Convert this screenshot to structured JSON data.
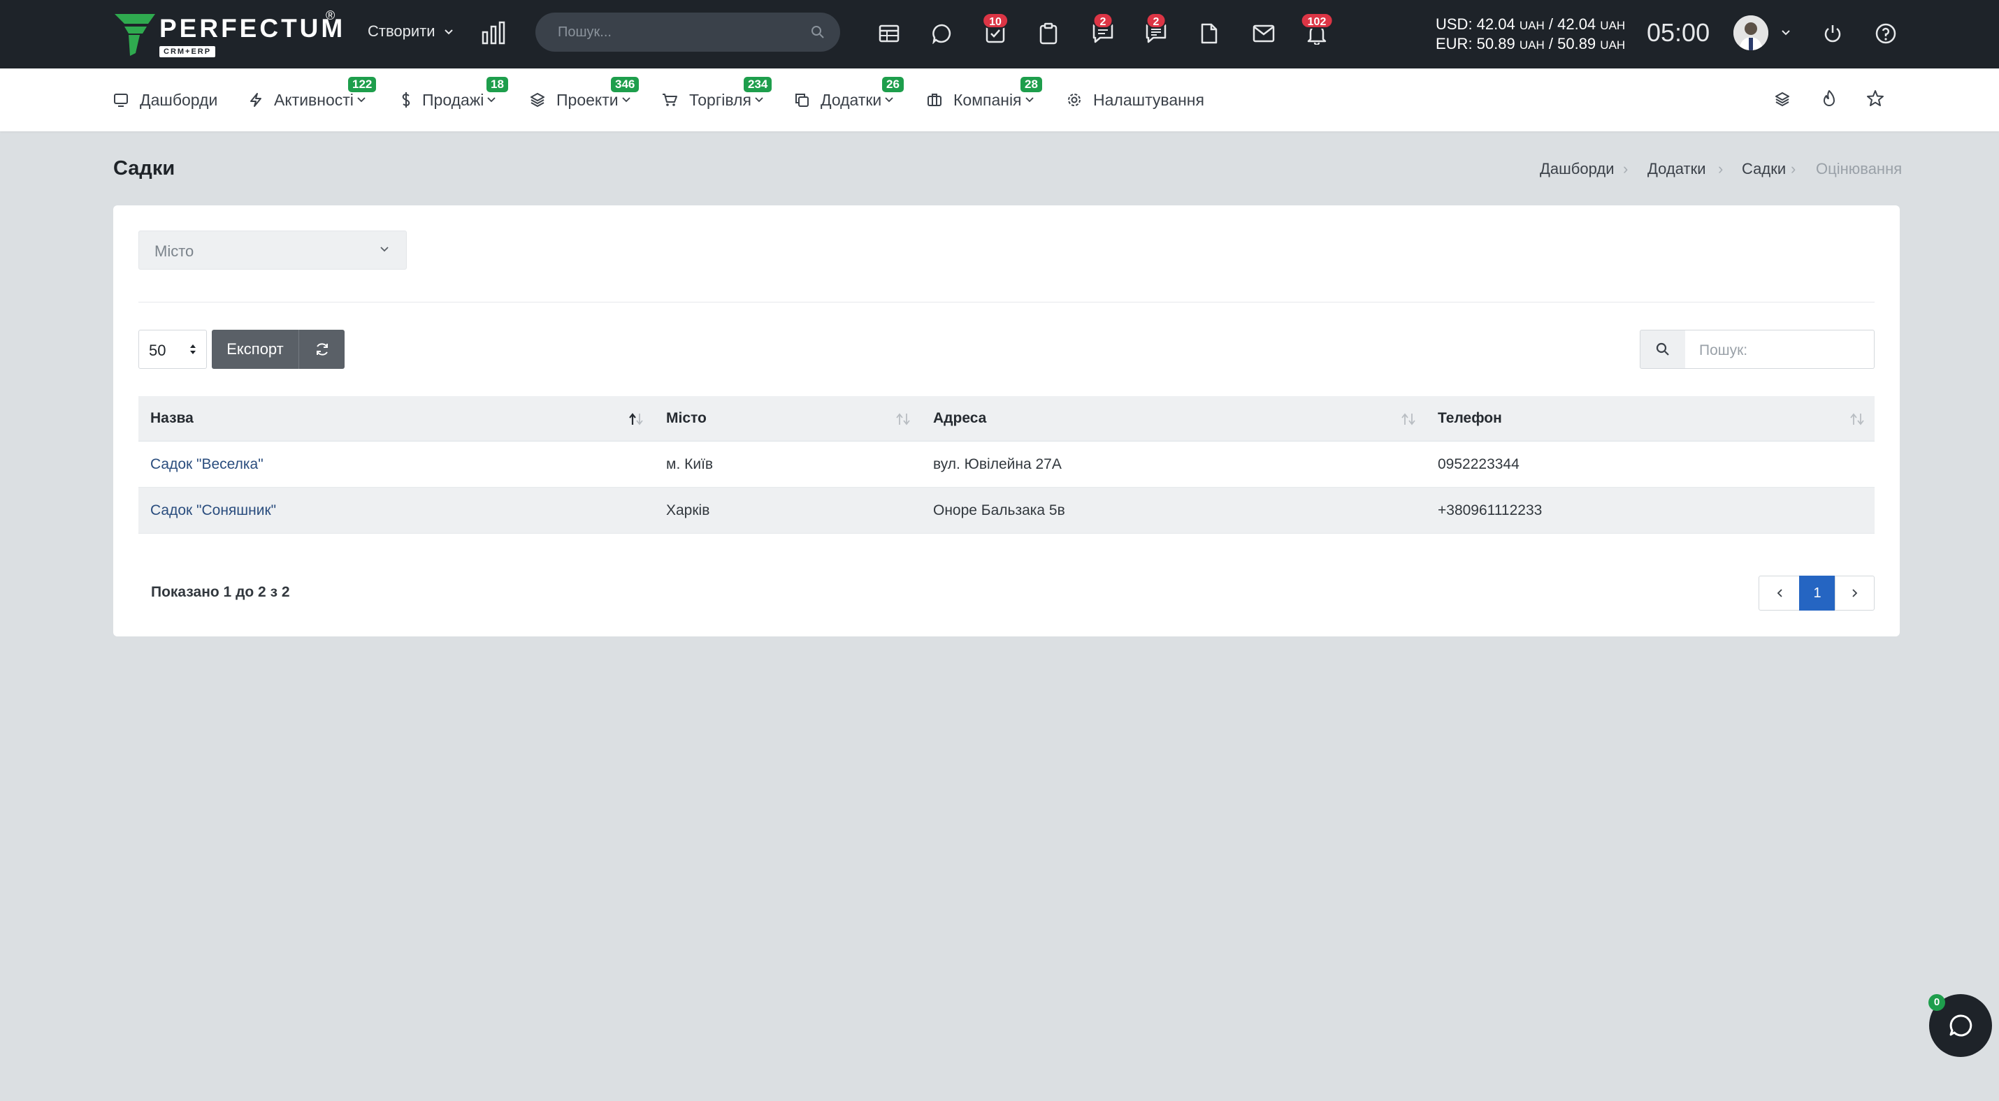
{
  "topbar": {
    "logo_text": "PERFECTUM",
    "logo_sub": "CRM+ERP",
    "logo_reg": "®",
    "create_label": "Створити",
    "search_placeholder": "Пошук...",
    "badges": {
      "tasks": "10",
      "chat": "2",
      "messages": "2",
      "notifications": "102"
    },
    "currency_usd_label": "USD: 42.04",
    "currency_usd_unit1": "UAH",
    "currency_usd_mid": "/ 42.04",
    "currency_usd_unit2": "UAH",
    "currency_eur_label": "EUR: 50.89",
    "currency_eur_unit1": "UAH",
    "currency_eur_mid": "/ 50.89",
    "currency_eur_unit2": "UAH",
    "clock": "05:00"
  },
  "nav": {
    "items": [
      {
        "label": "Дашборди",
        "badge": ""
      },
      {
        "label": "Активності",
        "badge": "122"
      },
      {
        "label": "Продажі",
        "badge": "18"
      },
      {
        "label": "Проекти",
        "badge": "346"
      },
      {
        "label": "Торгівля",
        "badge": "234"
      },
      {
        "label": "Додатки",
        "badge": "26"
      },
      {
        "label": "Компанія",
        "badge": "28"
      },
      {
        "label": "Налаштування",
        "badge": ""
      }
    ]
  },
  "page": {
    "title": "Садки",
    "breadcrumb": [
      "Дашборди",
      "Додатки",
      "Садки",
      "Оцінювання"
    ]
  },
  "filters": {
    "city_placeholder": "Місто"
  },
  "table_controls": {
    "page_length": "50",
    "export_label": "Експорт",
    "search_placeholder": "Пошук:"
  },
  "table": {
    "headers": [
      "Назва",
      "Місто",
      "Адреса",
      "Телефон"
    ],
    "rows": [
      [
        "Садок \"Веселка\"",
        "м. Київ",
        "вул. Ювілейна 27А",
        "0952223344"
      ],
      [
        "Садок \"Соняшник\"",
        "Харків",
        "Оноре Бальзака 5в",
        "+380961112233"
      ]
    ]
  },
  "pagination": {
    "info": "Показано 1 до 2 з 2",
    "current_page": "1"
  },
  "chat_widget": {
    "badge": "0"
  },
  "colors": {
    "topbar_bg": "#1e2329",
    "badge_red": "#dc3545",
    "badge_green": "#1e9e4c",
    "page_bg": "#dbdfe2",
    "accent_blue": "#2565c2",
    "link_blue": "#2a4d7e"
  }
}
